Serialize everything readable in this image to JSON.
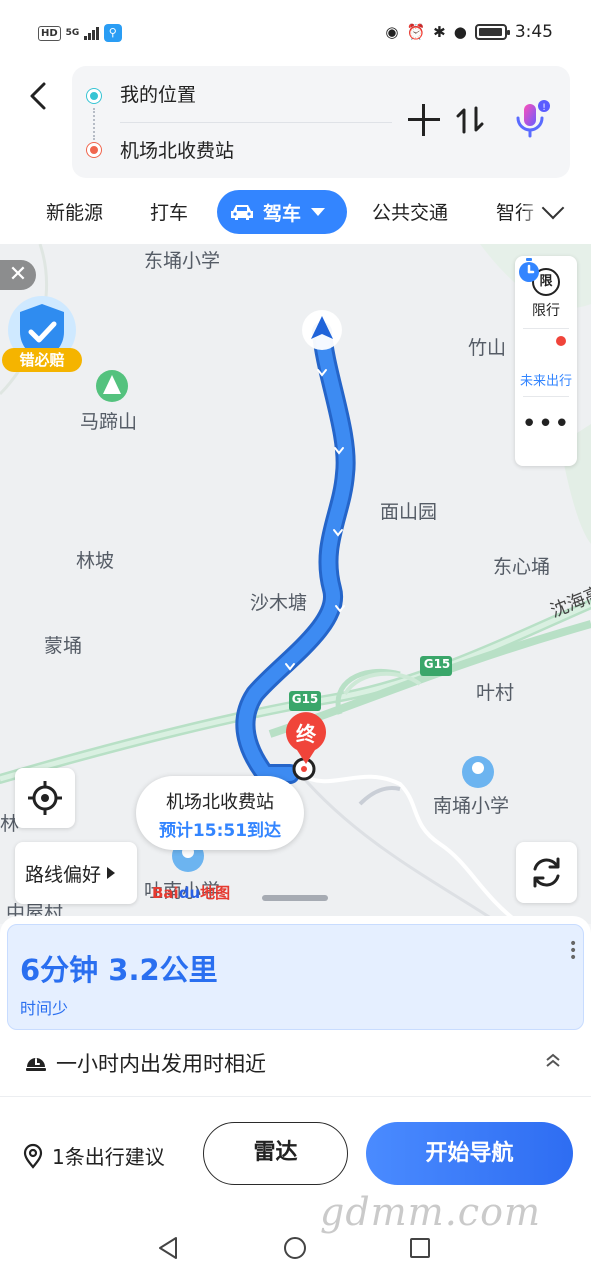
{
  "status_bar": {
    "left": {
      "hd": "HD",
      "net": "5G"
    },
    "time": "3:45"
  },
  "header": {
    "back_icon": "chevron-left-icon",
    "start": "我的位置",
    "end": "机场北收费站",
    "add_icon": "plus-icon",
    "swap_icon": "swap-icon",
    "voice_icon": "microphone-icon"
  },
  "tabs": {
    "items": [
      "新能源",
      "打车",
      "公共交通",
      "智行"
    ],
    "active": "驾车",
    "active_icon": "car-icon",
    "expand_icon": "chevron-down-icon"
  },
  "map": {
    "places": [
      "东埇小学",
      "马蹄山",
      "竹山",
      "面山园",
      "林坡",
      "东心埇",
      "沙木塘",
      "蒙埇",
      "沈海高速",
      "叶村",
      "南埇小学",
      "吐南小学",
      "中屋村",
      "林"
    ],
    "road_badges": [
      "G15",
      "G15"
    ],
    "promo_label": "错必赔",
    "side_panel": {
      "limit_icon_text": "限",
      "limit_label": "限行",
      "future_label": "未来出行",
      "more": "•••"
    },
    "route_pref": "路线偏好",
    "destination": {
      "name": "机场北收费站",
      "eta": "预计15:51到达",
      "pin_text": "终"
    },
    "logo": {
      "bai": "Bai",
      "du": "du",
      "map": "地图"
    },
    "colors": {
      "route": "#3d8bf2",
      "route_border": "#2565c9",
      "highway": "#b8e0c6"
    }
  },
  "route_card": {
    "time_distance": "6分钟  3.2公里",
    "tag": "时间少"
  },
  "hint": {
    "text": "一小时内出发用时相近"
  },
  "actions": {
    "suggestion": "1条出行建议",
    "radar": "雷达",
    "start_nav": "开始导航"
  },
  "watermark": "gdmm.com"
}
